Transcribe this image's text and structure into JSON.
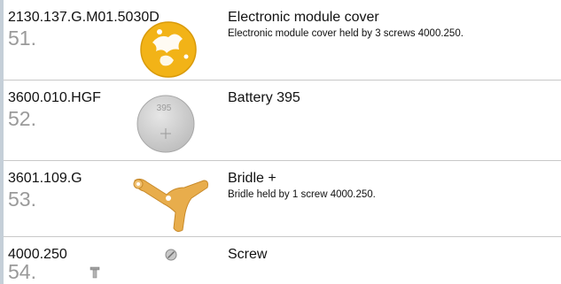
{
  "parts": [
    {
      "reference": "2130.137.G.M01.5030D",
      "position": "51.",
      "name": "Electronic module cover",
      "description": "Electronic module cover held by 3 screws 4000.250.",
      "image": "electronic-module-cover-image",
      "color": "#f2b317"
    },
    {
      "reference": "3600.010.HGF",
      "position": "52.",
      "name": "Battery 395",
      "description": "",
      "image": "battery-image",
      "image_text": "395",
      "color": "#cfcfcf"
    },
    {
      "reference": "3601.109.G",
      "position": "53.",
      "name": "Bridle +",
      "description": "Bridle held by 1 screw 4000.250.",
      "image": "bridle-image",
      "color": "#e8ad4c"
    },
    {
      "reference": "4000.250",
      "position": "54.",
      "name": "Screw",
      "description": "",
      "image": "screw-image",
      "color": "#9a9a9a"
    }
  ]
}
